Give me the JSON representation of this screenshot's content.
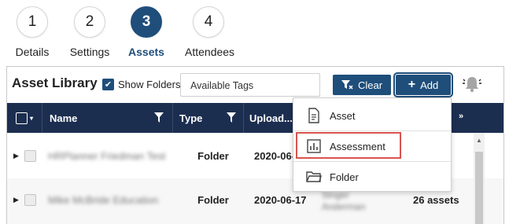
{
  "stepper": {
    "steps": [
      {
        "number": "1",
        "label": "Details",
        "active": false
      },
      {
        "number": "2",
        "label": "Settings",
        "active": false
      },
      {
        "number": "3",
        "label": "Assets",
        "active": true
      },
      {
        "number": "4",
        "label": "Attendees",
        "active": false
      }
    ]
  },
  "toolbar": {
    "title": "Asset Library",
    "show_folders_label": "Show Folders",
    "show_folders_checked": true,
    "tags_placeholder": "Available Tags",
    "clear_label": "Clear",
    "add_label": "Add"
  },
  "table": {
    "columns": [
      "Name",
      "Type",
      "Upload..."
    ],
    "rows": [
      {
        "name": "HRPlanner Friedman Test",
        "type": "Folder",
        "date": "2020-06-",
        "uploader": "",
        "assets": ""
      },
      {
        "name": "Mike McBride Education",
        "type": "Folder",
        "date": "2020-06-17",
        "uploader": "Singer Anderman",
        "assets": "26 assets"
      }
    ]
  },
  "add_menu": {
    "items": [
      "Asset",
      "Assessment",
      "Folder"
    ],
    "highlighted": "Assessment"
  },
  "colors": {
    "primary": "#1f4e7b",
    "header_bg": "#1c2e50",
    "highlight": "#d9534f"
  }
}
